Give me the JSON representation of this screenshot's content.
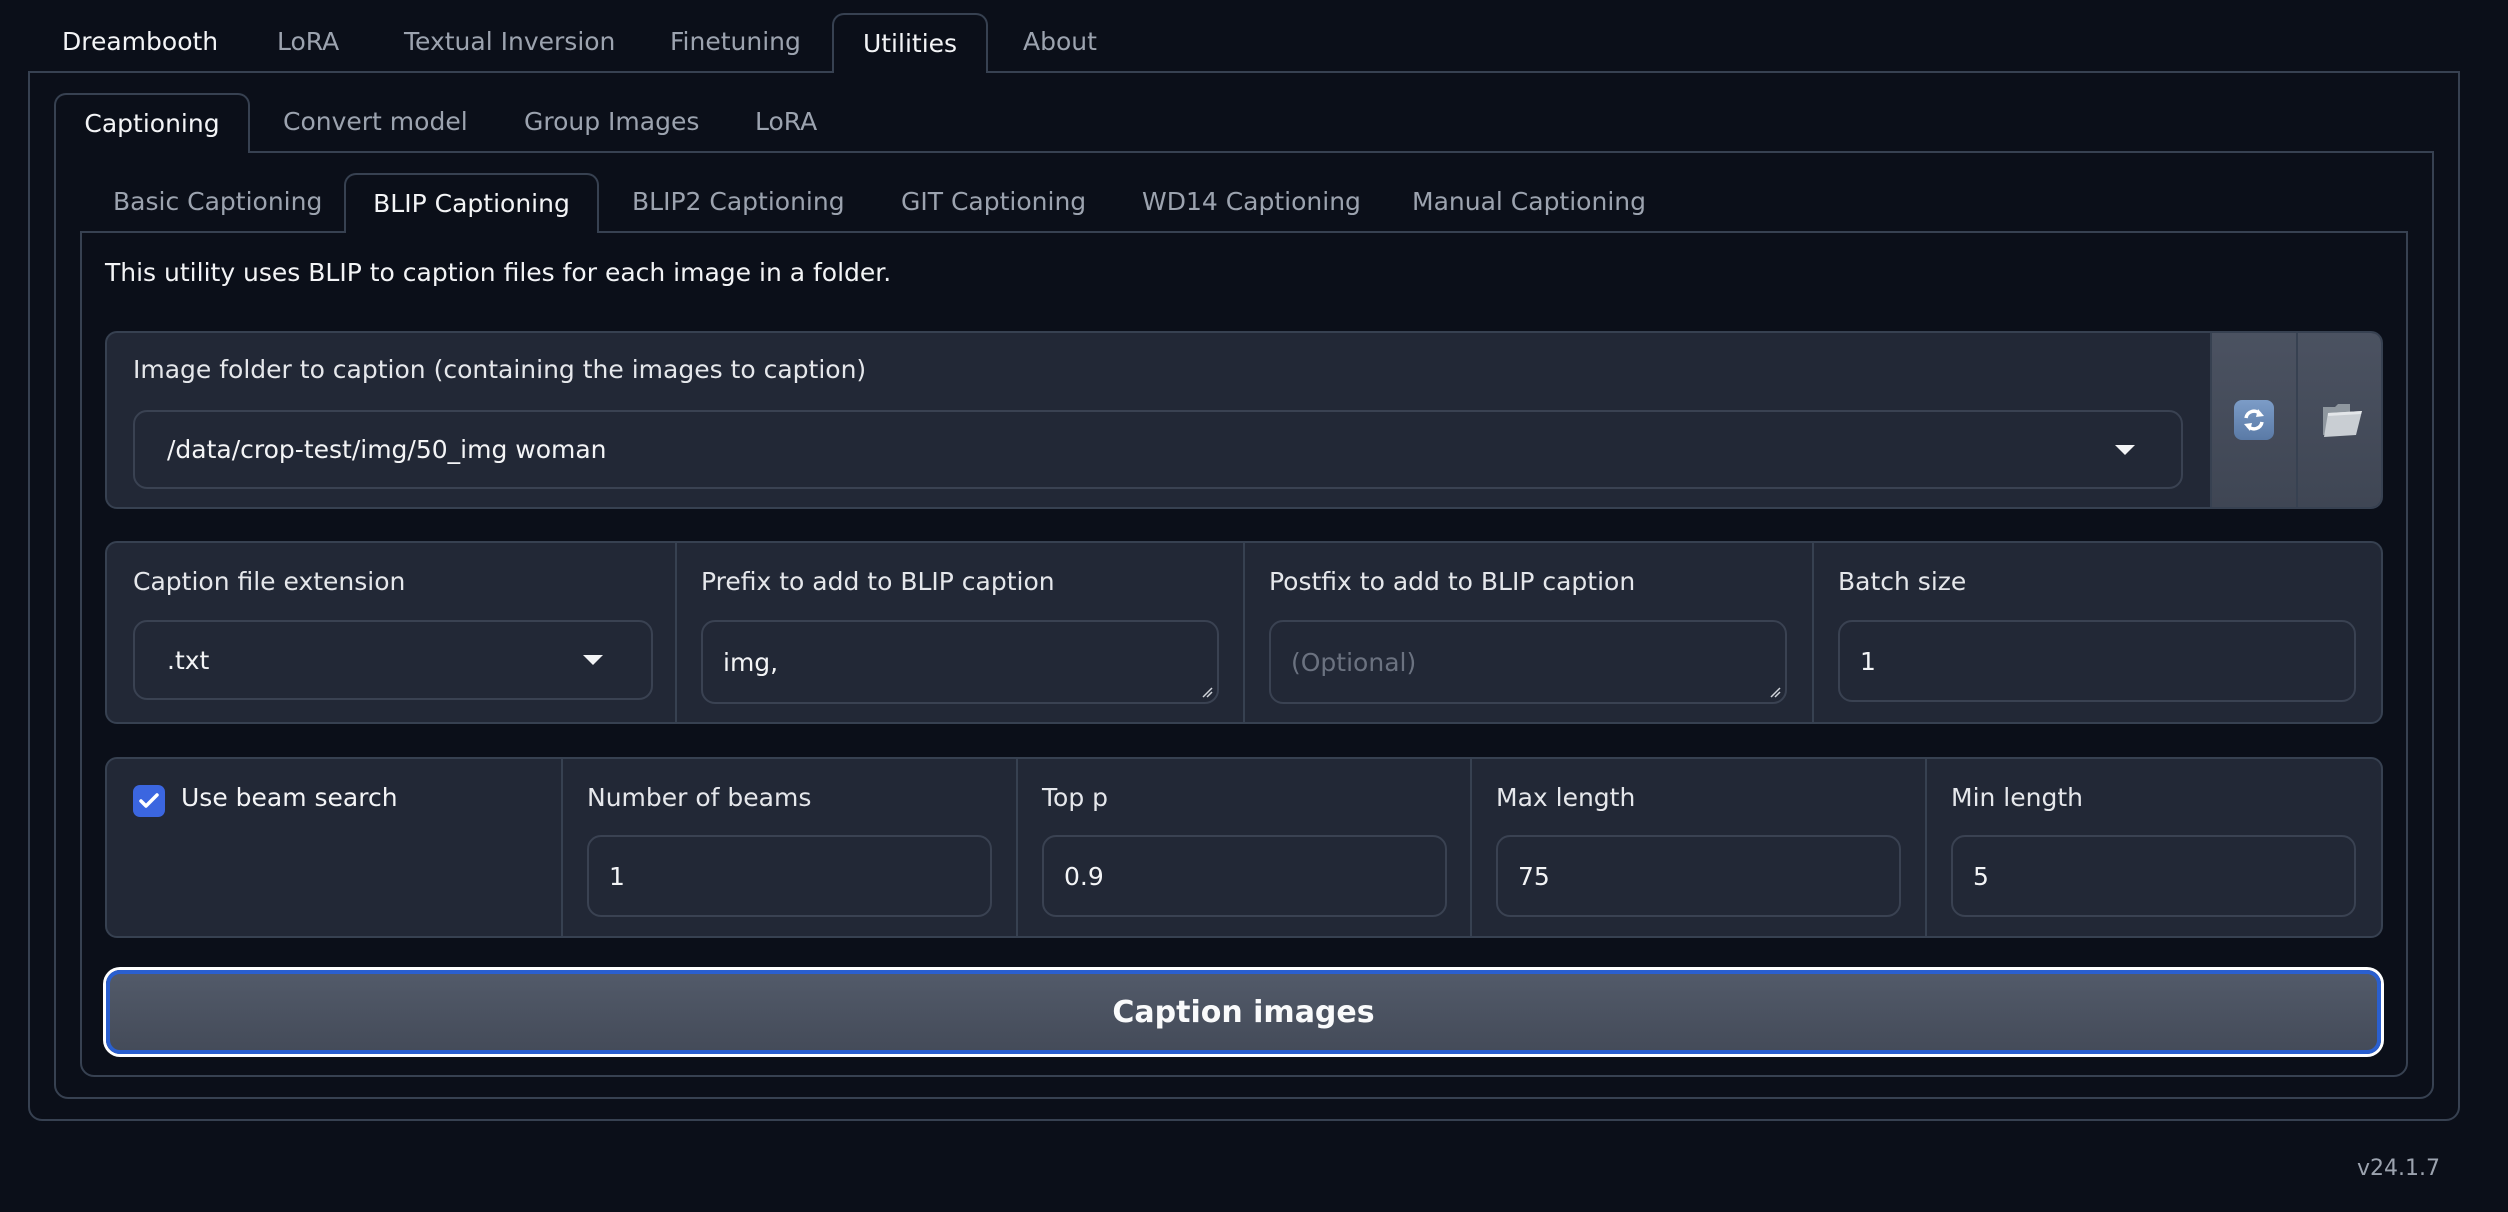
{
  "top_tabs": [
    {
      "label": "Dreambooth",
      "active": false
    },
    {
      "label": "LoRA",
      "active": false
    },
    {
      "label": "Textual Inversion",
      "active": false
    },
    {
      "label": "Finetuning",
      "active": false
    },
    {
      "label": "Utilities",
      "active": true
    },
    {
      "label": "About",
      "active": false
    }
  ],
  "utility_tabs": [
    {
      "label": "Captioning",
      "active": true
    },
    {
      "label": "Convert model",
      "active": false
    },
    {
      "label": "Group Images",
      "active": false
    },
    {
      "label": "LoRA",
      "active": false
    }
  ],
  "caption_tabs": [
    {
      "label": "Basic Captioning",
      "active": false
    },
    {
      "label": "BLIP Captioning",
      "active": true
    },
    {
      "label": "BLIP2 Captioning",
      "active": false
    },
    {
      "label": "GIT Captioning",
      "active": false
    },
    {
      "label": "WD14 Captioning",
      "active": false
    },
    {
      "label": "Manual Captioning",
      "active": false
    }
  ],
  "description": "This utility uses BLIP to caption files for each image in a folder.",
  "image_folder": {
    "label": "Image folder to caption (containing the images to caption)",
    "value": "/data/crop-test/img/50_img woman",
    "refresh_icon": "refresh-icon",
    "folder_icon": "open-folder-icon"
  },
  "caption_options": {
    "extension": {
      "label": "Caption file extension",
      "value": ".txt"
    },
    "prefix": {
      "label": "Prefix to add to BLIP caption",
      "value": "img,"
    },
    "postfix": {
      "label": "Postfix to add to BLIP caption",
      "value": "",
      "placeholder": "(Optional)"
    },
    "batch_size": {
      "label": "Batch size",
      "value": "1"
    }
  },
  "beam_options": {
    "use_beam_search": {
      "label": "Use beam search",
      "checked": true
    },
    "num_beams": {
      "label": "Number of beams",
      "value": "1"
    },
    "top_p": {
      "label": "Top p",
      "value": "0.9"
    },
    "max_length": {
      "label": "Max length",
      "value": "75"
    },
    "min_length": {
      "label": "Min length",
      "value": "5"
    }
  },
  "caption_button": "Caption images",
  "version": "v24.1.7",
  "colors": {
    "background": "#0b0f19",
    "panel": "#222836",
    "border": "#374151",
    "accent": "#3b66e0"
  }
}
